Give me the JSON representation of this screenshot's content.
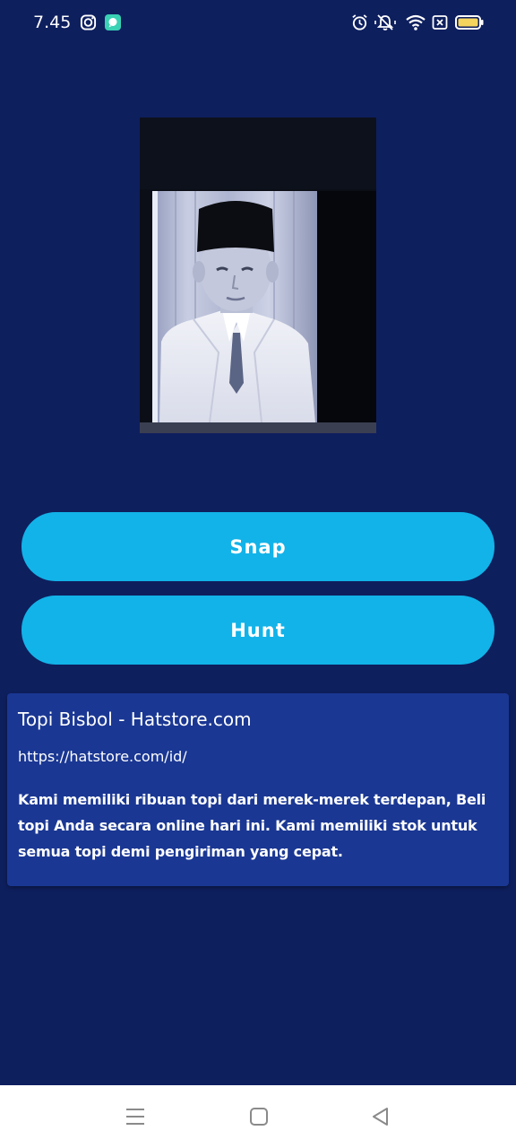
{
  "status_bar": {
    "time": "7.45",
    "left_icons": [
      "instagram-icon",
      "chat-bubble-icon"
    ],
    "right_icons": [
      "alarm-icon",
      "vibrate-mute-icon",
      "wifi-icon",
      "sim-x-icon",
      "battery-icon"
    ]
  },
  "photo": {
    "description_icon": "portrait-photo"
  },
  "buttons": {
    "snap_label": "Snap",
    "hunt_label": "Hunt"
  },
  "result": {
    "title": "Topi Bisbol - Hatstore.com",
    "url": "https://hatstore.com/id/",
    "description": "Kami memiliki ribuan topi dari merek-merek terdepan, Beli topi Anda secara online hari ini. Kami memiliki stok untuk semua topi demi pengiriman yang cepat."
  },
  "nav_bar": {
    "icons": [
      "menu-icon",
      "home-icon",
      "back-icon"
    ]
  },
  "colors": {
    "background": "#0e1f5e",
    "accent": "#12b3e8",
    "card": "#1a3793"
  }
}
